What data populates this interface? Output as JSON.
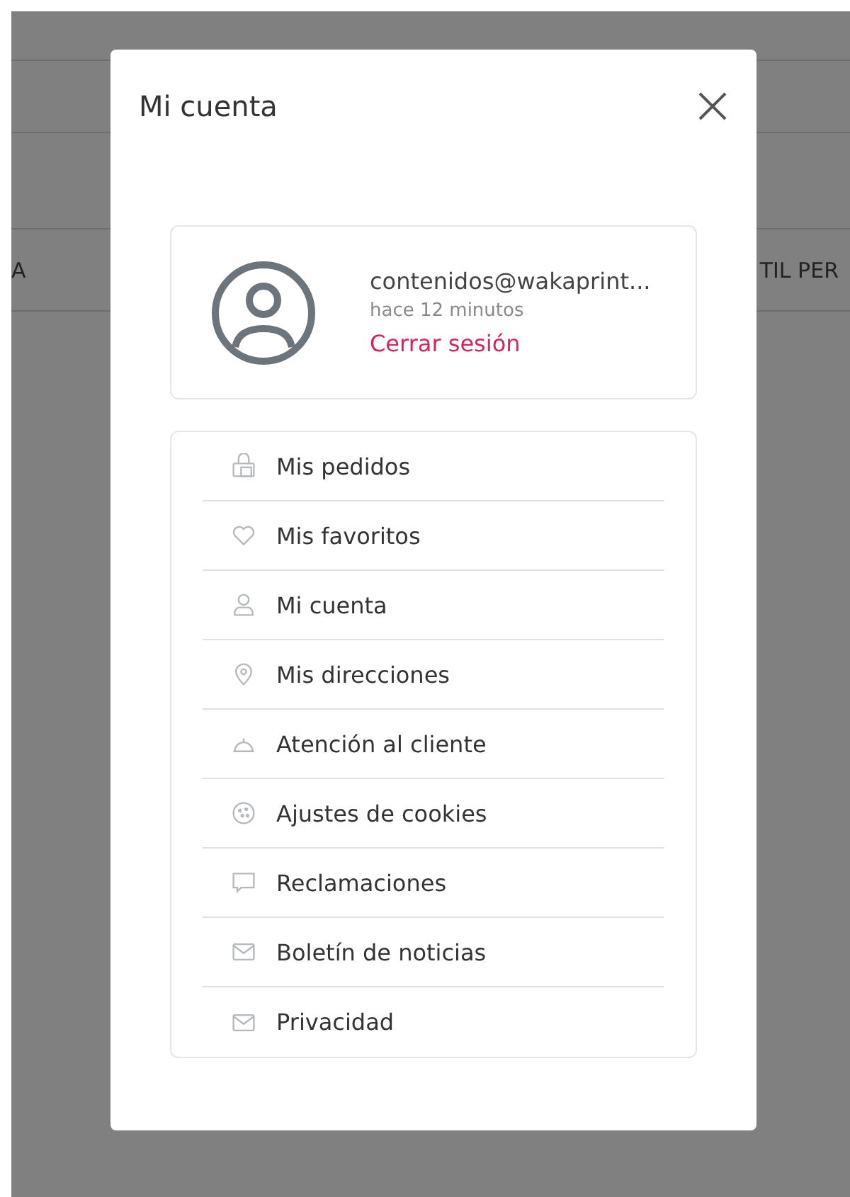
{
  "background": {
    "cells": [
      "A",
      "TIL PER"
    ]
  },
  "dialog": {
    "title": "Mi cuenta",
    "profile": {
      "email": "contenidos@wakaprint...",
      "last_seen": "hace 12 minutos",
      "logout": "Cerrar sesión"
    },
    "menu": [
      {
        "kind": "orders",
        "label": "Mis pedidos"
      },
      {
        "kind": "favorites",
        "label": "Mis favoritos"
      },
      {
        "kind": "account",
        "label": "Mi cuenta"
      },
      {
        "kind": "addresses",
        "label": "Mis direcciones"
      },
      {
        "kind": "support",
        "label": "Atención al cliente"
      },
      {
        "kind": "cookies",
        "label": "Ajustes de cookies"
      },
      {
        "kind": "claims",
        "label": "Reclamaciones"
      },
      {
        "kind": "newsletter",
        "label": "Boletín de noticias"
      },
      {
        "kind": "privacy",
        "label": "Privacidad"
      }
    ]
  }
}
